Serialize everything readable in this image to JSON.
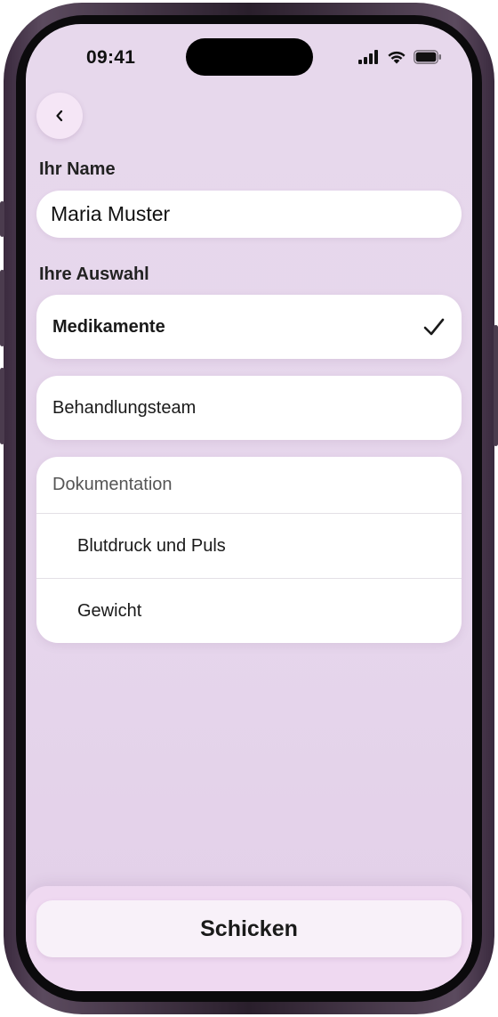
{
  "status_bar": {
    "time": "09:41",
    "icons": [
      "signal-icon",
      "wifi-icon",
      "battery-icon"
    ]
  },
  "nav": {
    "back_icon": "chevron-left-icon"
  },
  "form": {
    "name_label": "Ihr Name",
    "name_value": "Maria Muster",
    "selection_label": "Ihre Auswahl"
  },
  "options": [
    {
      "label": "Medikamente",
      "selected": true,
      "icon": "checkmark-icon"
    },
    {
      "label": "Behandlungsteam",
      "selected": false
    }
  ],
  "documentation": {
    "header": "Dokumentation",
    "items": [
      {
        "label": "Blutdruck und Puls"
      },
      {
        "label": "Gewicht"
      }
    ]
  },
  "actions": {
    "send_label": "Schicken"
  }
}
